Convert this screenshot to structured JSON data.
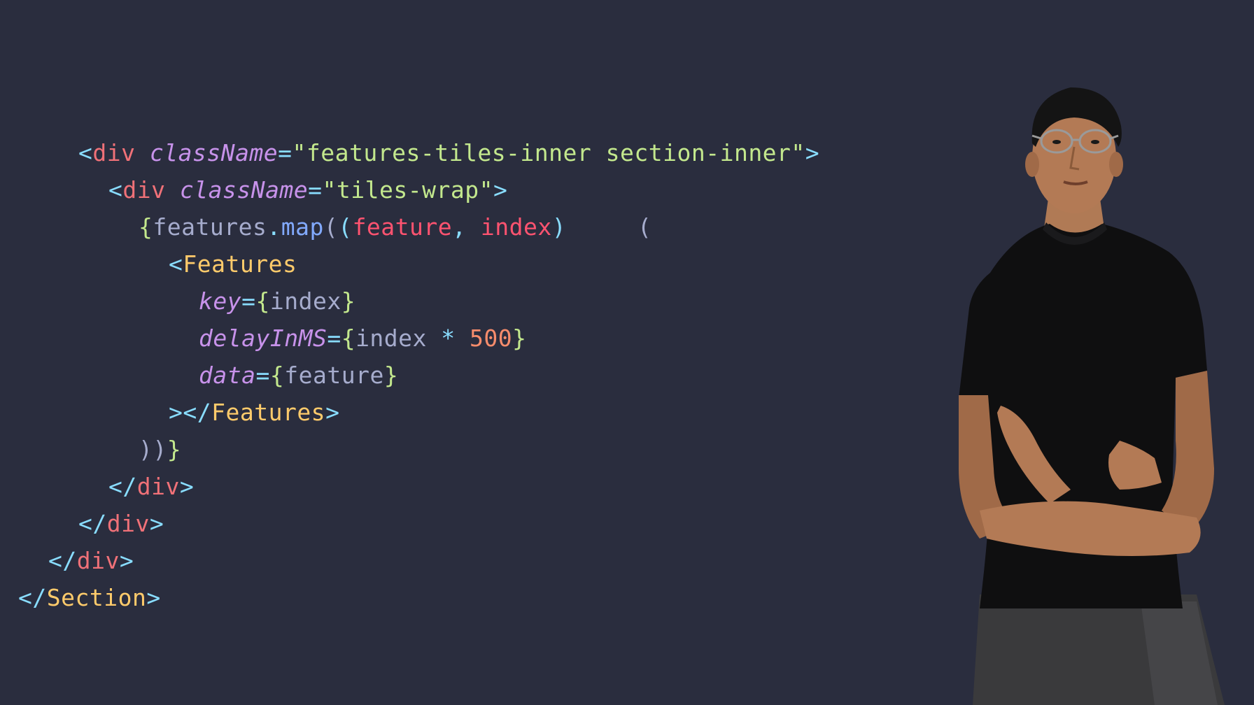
{
  "code": {
    "lines": [
      {
        "tokens": [
          {
            "text": "<",
            "color": "#89ddff",
            "italic": false
          },
          {
            "text": "div",
            "color": "#f07178",
            "italic": false
          },
          {
            "text": " ",
            "color": "#a6accd",
            "italic": false
          },
          {
            "text": "className",
            "color": "#c792ea",
            "italic": true
          },
          {
            "text": "=",
            "color": "#89ddff",
            "italic": false
          },
          {
            "text": "\"features-tiles-inner section-inner\"",
            "color": "#c3e88d",
            "italic": false
          },
          {
            "text": ">",
            "color": "#89ddff",
            "italic": false
          }
        ]
      },
      {
        "tokens": [
          {
            "text": "<",
            "color": "#89ddff",
            "italic": false
          },
          {
            "text": "div",
            "color": "#f07178",
            "italic": false
          },
          {
            "text": " ",
            "color": "#a6accd",
            "italic": false
          },
          {
            "text": "className",
            "color": "#c792ea",
            "italic": true
          },
          {
            "text": "=",
            "color": "#89ddff",
            "italic": false
          },
          {
            "text": "\"tiles-wrap\"",
            "color": "#c3e88d",
            "italic": false
          },
          {
            "text": ">",
            "color": "#89ddff",
            "italic": false
          }
        ]
      },
      {
        "tokens": [
          {
            "text": "{",
            "color": "#c3e88d",
            "italic": false
          },
          {
            "text": "features",
            "color": "#a6accd",
            "italic": false
          },
          {
            "text": ".",
            "color": "#89ddff",
            "italic": false
          },
          {
            "text": "map",
            "color": "#82aaff",
            "italic": false
          },
          {
            "text": "(",
            "color": "#a6accd",
            "italic": false
          },
          {
            "text": "(",
            "color": "#89ddff",
            "italic": false
          },
          {
            "text": "feature",
            "color": "#ff5370",
            "italic": false
          },
          {
            "text": ", ",
            "color": "#89ddff",
            "italic": false
          },
          {
            "text": "index",
            "color": "#ff5370",
            "italic": false
          },
          {
            "text": ")",
            "color": "#89ddff",
            "italic": false
          },
          {
            "text": "     ",
            "color": "#a6accd",
            "italic": false
          },
          {
            "text": "(",
            "color": "#a6accd",
            "italic": false
          }
        ]
      },
      {
        "tokens": [
          {
            "text": "<",
            "color": "#89ddff",
            "italic": false
          },
          {
            "text": "Features",
            "color": "#ffcb6b",
            "italic": false
          }
        ]
      },
      {
        "tokens": [
          {
            "text": "key",
            "color": "#c792ea",
            "italic": true
          },
          {
            "text": "=",
            "color": "#89ddff",
            "italic": false
          },
          {
            "text": "{",
            "color": "#c3e88d",
            "italic": false
          },
          {
            "text": "index",
            "color": "#a6accd",
            "italic": false
          },
          {
            "text": "}",
            "color": "#c3e88d",
            "italic": false
          }
        ]
      },
      {
        "tokens": [
          {
            "text": "delayInMS",
            "color": "#c792ea",
            "italic": true
          },
          {
            "text": "=",
            "color": "#89ddff",
            "italic": false
          },
          {
            "text": "{",
            "color": "#c3e88d",
            "italic": false
          },
          {
            "text": "index",
            "color": "#a6accd",
            "italic": false
          },
          {
            "text": " * ",
            "color": "#89ddff",
            "italic": false
          },
          {
            "text": "500",
            "color": "#f78c6c",
            "italic": false
          },
          {
            "text": "}",
            "color": "#c3e88d",
            "italic": false
          }
        ]
      },
      {
        "tokens": [
          {
            "text": "data",
            "color": "#c792ea",
            "italic": true
          },
          {
            "text": "=",
            "color": "#89ddff",
            "italic": false
          },
          {
            "text": "{",
            "color": "#c3e88d",
            "italic": false
          },
          {
            "text": "feature",
            "color": "#a6accd",
            "italic": false
          },
          {
            "text": "}",
            "color": "#c3e88d",
            "italic": false
          }
        ]
      },
      {
        "tokens": [
          {
            "text": "></",
            "color": "#89ddff",
            "italic": false
          },
          {
            "text": "Features",
            "color": "#ffcb6b",
            "italic": false
          },
          {
            "text": ">",
            "color": "#89ddff",
            "italic": false
          }
        ]
      },
      {
        "tokens": [
          {
            "text": "))",
            "color": "#a6accd",
            "italic": false
          },
          {
            "text": "}",
            "color": "#c3e88d",
            "italic": false
          }
        ]
      },
      {
        "tokens": [
          {
            "text": "</",
            "color": "#89ddff",
            "italic": false
          },
          {
            "text": "div",
            "color": "#f07178",
            "italic": false
          },
          {
            "text": ">",
            "color": "#89ddff",
            "italic": false
          }
        ]
      },
      {
        "tokens": [
          {
            "text": "</",
            "color": "#89ddff",
            "italic": false
          },
          {
            "text": "div",
            "color": "#f07178",
            "italic": false
          },
          {
            "text": ">",
            "color": "#89ddff",
            "italic": false
          }
        ]
      },
      {
        "tokens": [
          {
            "text": "</",
            "color": "#89ddff",
            "italic": false
          },
          {
            "text": "div",
            "color": "#f07178",
            "italic": false
          },
          {
            "text": ">",
            "color": "#89ddff",
            "italic": false
          }
        ]
      },
      {
        "tokens": [
          {
            "text": "</",
            "color": "#89ddff",
            "italic": false
          },
          {
            "text": "Section",
            "color": "#ffcb6b",
            "italic": false
          },
          {
            "text": ">",
            "color": "#89ddff",
            "italic": false
          }
        ]
      }
    ]
  },
  "theme": {
    "background": "#2a2d3e"
  },
  "presenter": {
    "icon": "presenter-person"
  }
}
